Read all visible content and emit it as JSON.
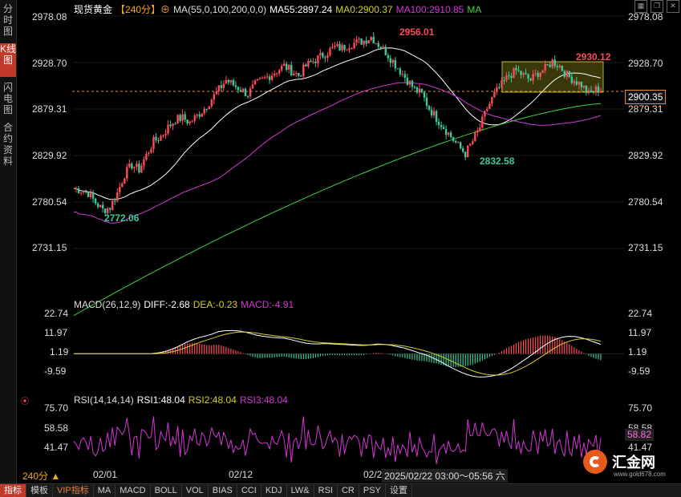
{
  "sidebar": {
    "tabs": [
      {
        "label": "分时图"
      },
      {
        "label": "K线图"
      },
      {
        "label": "闪电图"
      },
      {
        "label": "合约资料"
      }
    ]
  },
  "header": {
    "symbol": "现货黄金",
    "period": "【240分】",
    "ma_params": "MA(55,0,100,200,0,0)",
    "ma55": "MA55:2897.24",
    "ma0": "MA0:2900.37",
    "ma100": "MA100:2910.85",
    "ma": "MA"
  },
  "main_axis": {
    "labels": [
      "2978.08",
      "2928.70",
      "2879.31",
      "2829.92",
      "2780.54",
      "2731.15"
    ],
    "min": 2731.15,
    "max": 2978.08
  },
  "annotations": {
    "high": "2956.01",
    "low": "2772.06",
    "swing_low": "2832.58",
    "recent_high": "2930.12"
  },
  "current_price": "2900.35",
  "macd": {
    "title": "MACD(26,12,9)",
    "diff": "DIFF:-2.68",
    "dea": "DEA:-0.23",
    "macd": "MACD:-4.91",
    "labels": [
      "22.74",
      "11.97",
      "1.19",
      "-9.59"
    ]
  },
  "rsi": {
    "title": "RSI(14,14,14)",
    "rsi1": "RSI1:48.04",
    "rsi2": "RSI2:48.04",
    "rsi3": "RSI3:48.04",
    "labels": [
      "75.70",
      "58.58",
      "41.47"
    ],
    "current": "58.82"
  },
  "xaxis": {
    "labels": [
      "02/01",
      "02/12",
      "02/2"
    ]
  },
  "timeframe_label": "240分 ▲",
  "crosshair_time": "2025/02/22 03:00～05:56 六",
  "bottom_tabs": [
    "指标",
    "模板",
    "VIP指标",
    "MA",
    "MACD",
    "BOLL",
    "VOL",
    "BIAS",
    "CCI",
    "KDJ",
    "LW&",
    "RSI",
    "CR",
    "PSY",
    "设置"
  ],
  "logo": {
    "name": "汇金网",
    "url": "www.gold678.com"
  },
  "colors": {
    "up": "#ff4a5a",
    "down": "#3ec99b",
    "ma55": "#ffffff",
    "ma0": "#d4cf2b",
    "ma100": "#d437d4",
    "ma200": "#3bd43b",
    "accent": "#c0392b"
  },
  "chart_data": {
    "type": "candlestick",
    "close_series": [
      2795,
      2793,
      2790,
      2780,
      2772,
      2775,
      2790,
      2810,
      2820,
      2815,
      2830,
      2845,
      2850,
      2860,
      2868,
      2870,
      2865,
      2872,
      2880,
      2890,
      2900,
      2910,
      2905,
      2900,
      2895,
      2905,
      2910,
      2915,
      2920,
      2925,
      2920,
      2915,
      2925,
      2930,
      2935,
      2940,
      2945,
      2944,
      2948,
      2950,
      2952,
      2956,
      2948,
      2940,
      2930,
      2920,
      2910,
      2900,
      2895,
      2880,
      2870,
      2860,
      2850,
      2840,
      2832,
      2845,
      2860,
      2880,
      2895,
      2905,
      2915,
      2920,
      2915,
      2910,
      2918,
      2922,
      2930,
      2925,
      2915,
      2910,
      2905,
      2895,
      2900
    ],
    "ma200_range": [
      2660,
      2885
    ],
    "ma100_range": [
      2740,
      2910
    ],
    "ma55_range": [
      2760,
      2897
    ]
  }
}
